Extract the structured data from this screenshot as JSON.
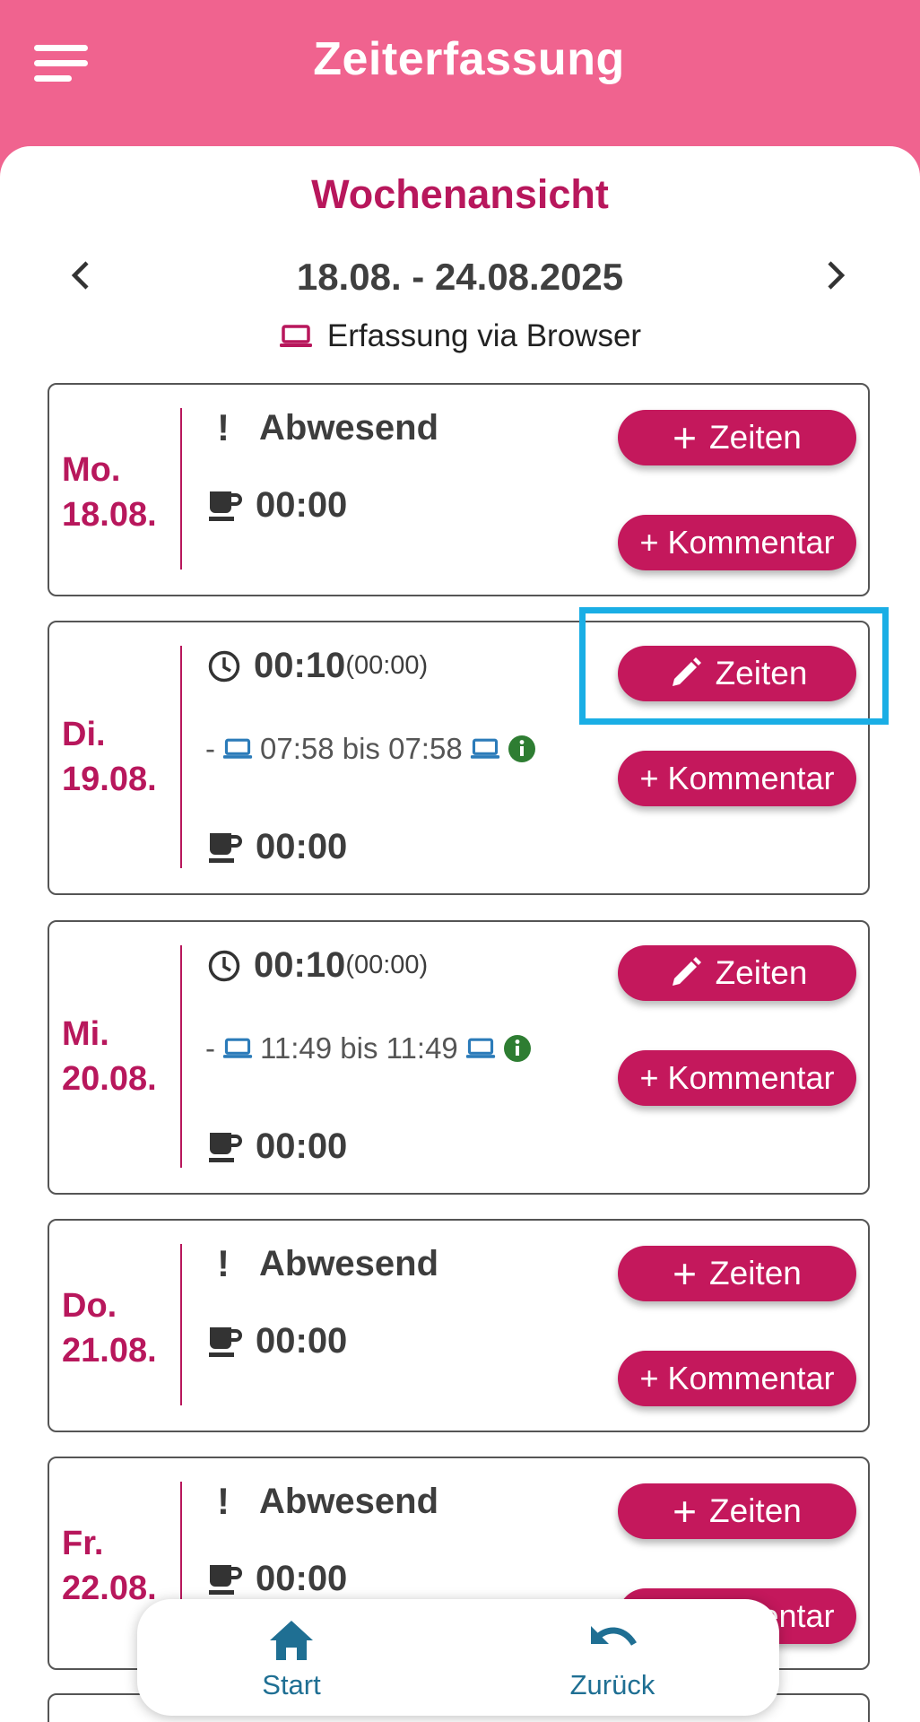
{
  "header": {
    "title": "Zeiterfassung"
  },
  "week": {
    "section_title": "Wochenansicht",
    "range": "18.08. - 24.08.2025",
    "capture_mode": "Erfassung via Browser"
  },
  "days": [
    {
      "weekday": "Mo.",
      "date": "18.08.",
      "status": "Abwesend",
      "pause": "00:00",
      "times_label": "Zeiten",
      "comment_label": "Kommentar"
    },
    {
      "weekday": "Di.",
      "date": "19.08.",
      "worked": "00:10",
      "worked_extra": "(00:00)",
      "entry_prefix": "-",
      "entry_time": "07:58 bis 07:58",
      "pause": "00:00",
      "times_label": "Zeiten",
      "comment_label": "Kommentar"
    },
    {
      "weekday": "Mi.",
      "date": "20.08.",
      "worked": "00:10",
      "worked_extra": "(00:00)",
      "entry_prefix": "-",
      "entry_time": "11:49 bis 11:49",
      "pause": "00:00",
      "times_label": "Zeiten",
      "comment_label": "Kommentar"
    },
    {
      "weekday": "Do.",
      "date": "21.08.",
      "status": "Abwesend",
      "pause": "00:00",
      "times_label": "Zeiten",
      "comment_label": "Kommentar"
    },
    {
      "weekday": "Fr.",
      "date": "22.08.",
      "status": "Abwesend",
      "pause": "00:00",
      "times_label": "Zeiten",
      "comment_label": "Kommentar"
    }
  ],
  "bottom_nav": {
    "start_label": "Start",
    "back_label": "Zurück"
  },
  "colors": {
    "header": "#F0638F",
    "accent": "#B8175C",
    "button": "#C4185C",
    "highlight": "#1AAEE5",
    "nav": "#1F6F93",
    "info_green": "#2E7D32",
    "device_blue": "#2B7BB9"
  }
}
